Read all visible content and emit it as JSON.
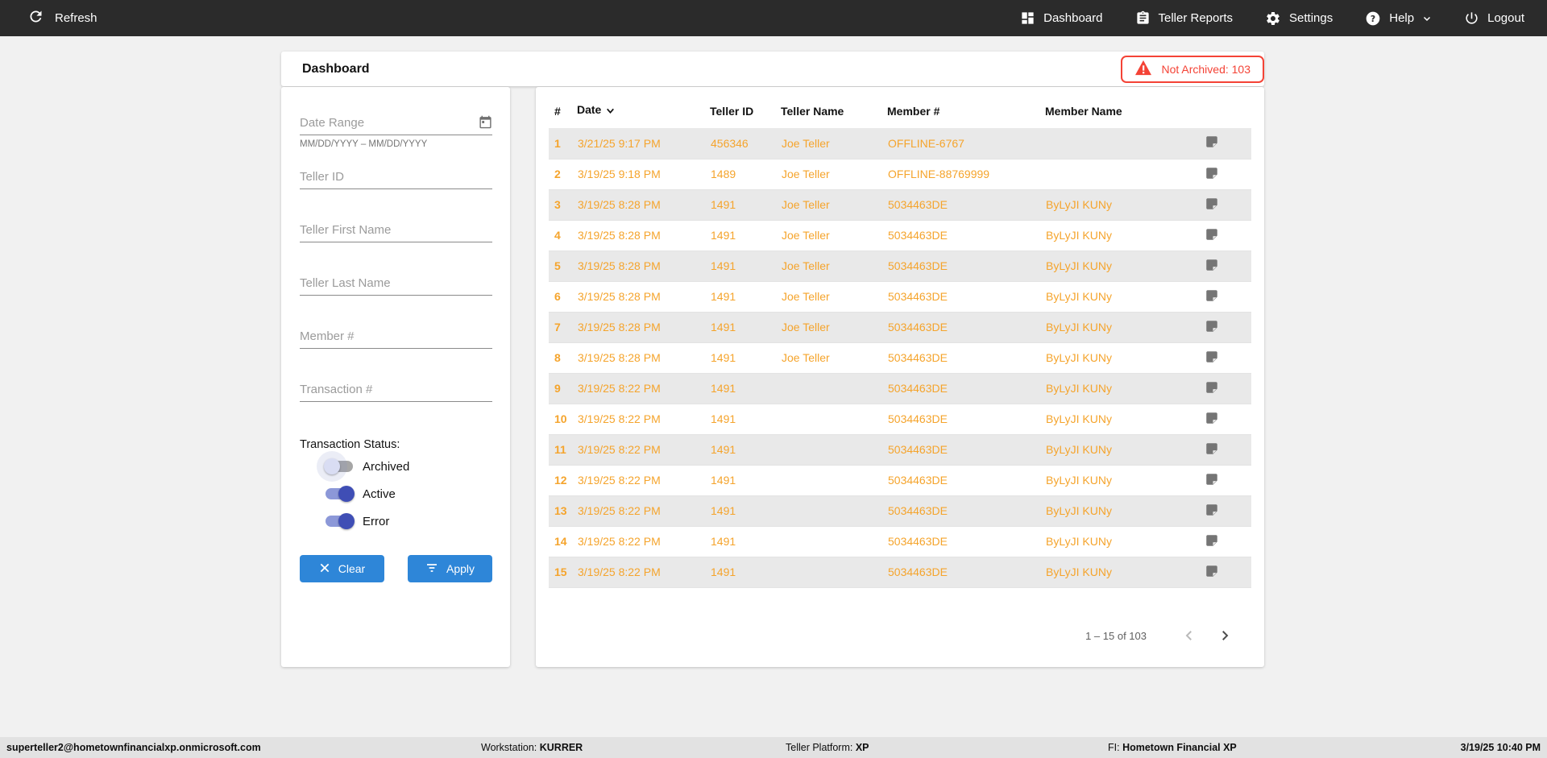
{
  "colors": {
    "row_text": "#F5A42C",
    "alert": "#F44336",
    "button": "#2E86D8",
    "toggle_on": "#3F4EB5",
    "toggle_on_track": "#8C98D8"
  },
  "navbar": {
    "refresh_label": "Refresh",
    "items": [
      {
        "label": "Dashboard",
        "icon": "dashboard-icon"
      },
      {
        "label": "Teller Reports",
        "icon": "clipboard-icon"
      },
      {
        "label": "Settings",
        "icon": "gear-icon"
      },
      {
        "label": "Help",
        "icon": "help-icon",
        "has_caret": true
      },
      {
        "label": "Logout",
        "icon": "power-icon"
      }
    ]
  },
  "header": {
    "title": "Dashboard",
    "badge_label": "Not Archived: 103"
  },
  "filters": {
    "fields": [
      {
        "label": "Date Range",
        "hint": "MM/DD/YYYY – MM/DD/YYYY",
        "icon": "calendar-icon"
      },
      {
        "label": "Teller ID"
      },
      {
        "label": "Teller First Name"
      },
      {
        "label": "Teller Last Name"
      },
      {
        "label": "Member #"
      },
      {
        "label": "Transaction #"
      }
    ],
    "status_label": "Transaction Status:",
    "toggles": [
      {
        "label": "Archived",
        "on": false
      },
      {
        "label": "Active",
        "on": true
      },
      {
        "label": "Error",
        "on": true
      }
    ],
    "clear_label": "Clear",
    "apply_label": "Apply"
  },
  "table": {
    "columns": [
      "#",
      "Date",
      "Teller ID",
      "Teller Name",
      "Member #",
      "Member Name"
    ],
    "sorted_column": "Date",
    "sort_direction": "desc",
    "rows": [
      {
        "num": "1",
        "date": "3/21/25 9:17 PM",
        "teller_id": "456346",
        "teller_name": "Joe Teller",
        "member_num": "OFFLINE-6767",
        "member_name": ""
      },
      {
        "num": "2",
        "date": "3/19/25 9:18 PM",
        "teller_id": "1489",
        "teller_name": "Joe Teller",
        "member_num": "OFFLINE-88769999",
        "member_name": ""
      },
      {
        "num": "3",
        "date": "3/19/25 8:28 PM",
        "teller_id": "1491",
        "teller_name": "Joe Teller",
        "member_num": "5034463DE",
        "member_name": "ByLyJI KUNy"
      },
      {
        "num": "4",
        "date": "3/19/25 8:28 PM",
        "teller_id": "1491",
        "teller_name": "Joe Teller",
        "member_num": "5034463DE",
        "member_name": "ByLyJI KUNy"
      },
      {
        "num": "5",
        "date": "3/19/25 8:28 PM",
        "teller_id": "1491",
        "teller_name": "Joe Teller",
        "member_num": "5034463DE",
        "member_name": "ByLyJI KUNy"
      },
      {
        "num": "6",
        "date": "3/19/25 8:28 PM",
        "teller_id": "1491",
        "teller_name": "Joe Teller",
        "member_num": "5034463DE",
        "member_name": "ByLyJI KUNy"
      },
      {
        "num": "7",
        "date": "3/19/25 8:28 PM",
        "teller_id": "1491",
        "teller_name": "Joe Teller",
        "member_num": "5034463DE",
        "member_name": "ByLyJI KUNy"
      },
      {
        "num": "8",
        "date": "3/19/25 8:28 PM",
        "teller_id": "1491",
        "teller_name": "Joe Teller",
        "member_num": "5034463DE",
        "member_name": "ByLyJI KUNy"
      },
      {
        "num": "9",
        "date": "3/19/25 8:22 PM",
        "teller_id": "1491",
        "teller_name": "",
        "member_num": "5034463DE",
        "member_name": "ByLyJI KUNy"
      },
      {
        "num": "10",
        "date": "3/19/25 8:22 PM",
        "teller_id": "1491",
        "teller_name": "",
        "member_num": "5034463DE",
        "member_name": "ByLyJI KUNy"
      },
      {
        "num": "11",
        "date": "3/19/25 8:22 PM",
        "teller_id": "1491",
        "teller_name": "",
        "member_num": "5034463DE",
        "member_name": "ByLyJI KUNy"
      },
      {
        "num": "12",
        "date": "3/19/25 8:22 PM",
        "teller_id": "1491",
        "teller_name": "",
        "member_num": "5034463DE",
        "member_name": "ByLyJI KUNy"
      },
      {
        "num": "13",
        "date": "3/19/25 8:22 PM",
        "teller_id": "1491",
        "teller_name": "",
        "member_num": "5034463DE",
        "member_name": "ByLyJI KUNy"
      },
      {
        "num": "14",
        "date": "3/19/25 8:22 PM",
        "teller_id": "1491",
        "teller_name": "",
        "member_num": "5034463DE",
        "member_name": "ByLyJI KUNy"
      },
      {
        "num": "15",
        "date": "3/19/25 8:22 PM",
        "teller_id": "1491",
        "teller_name": "",
        "member_num": "5034463DE",
        "member_name": "ByLyJI KUNy"
      }
    ],
    "pagination": {
      "range_label": "1 – 15 of 103"
    }
  },
  "footer": {
    "user": "superteller2@hometownfinancialxp.onmicrosoft.com",
    "workstation_label": "Workstation:",
    "workstation_value": "KURRER",
    "platform_label": "Teller Platform:",
    "platform_value": "XP",
    "fi_label": "FI:",
    "fi_value": "Hometown Financial XP",
    "timestamp": "3/19/25 10:40 PM"
  }
}
